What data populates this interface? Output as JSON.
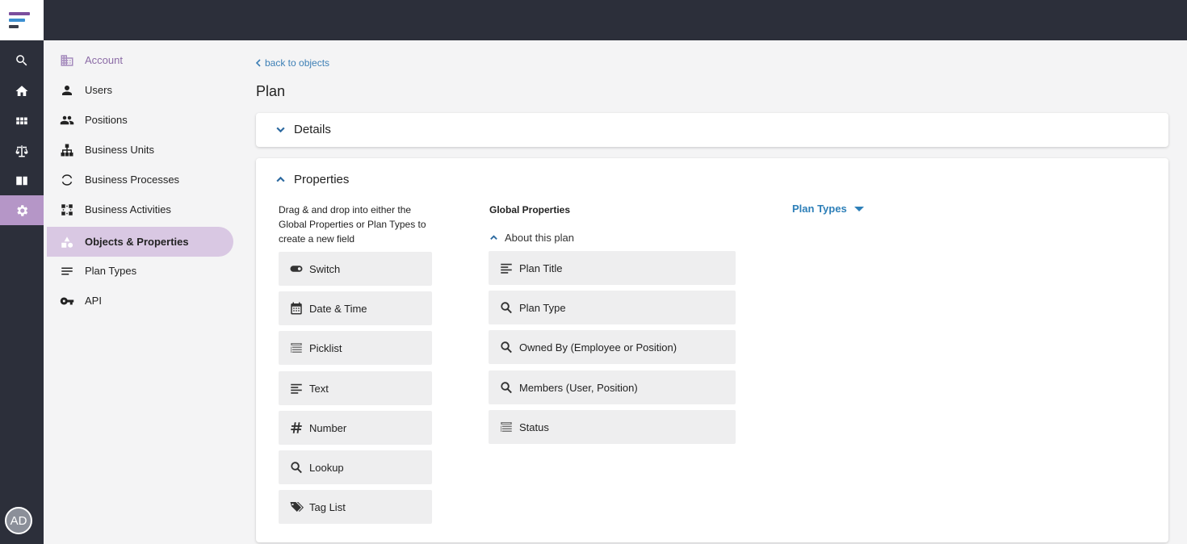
{
  "brand": {
    "logo_colors": [
      "#7b4e9d",
      "#3c8fd0",
      "#3b3f4c"
    ]
  },
  "rail": {
    "items": [
      {
        "icon": "search-icon",
        "active": false
      },
      {
        "icon": "home-icon",
        "active": false
      },
      {
        "icon": "grid-icon",
        "active": false
      },
      {
        "icon": "scales-icon",
        "active": false
      },
      {
        "icon": "book-icon",
        "active": false
      },
      {
        "icon": "gear-icon",
        "active": true
      }
    ],
    "avatar_initials": "AD"
  },
  "sidebar": {
    "items": [
      {
        "label": "Account",
        "icon": "building-icon"
      },
      {
        "label": "Users",
        "icon": "person-icon"
      },
      {
        "label": "Positions",
        "icon": "people-icon"
      },
      {
        "label": "Business Units",
        "icon": "hierarchy-icon"
      },
      {
        "label": "Business Processes",
        "icon": "cycle-icon"
      },
      {
        "label": "Business Activities",
        "icon": "activity-icon"
      },
      {
        "label": "Objects & Properties",
        "icon": "shapes-icon",
        "active": true
      },
      {
        "label": "Plan Types",
        "icon": "lines-icon"
      },
      {
        "label": "API",
        "icon": "key-icon"
      }
    ]
  },
  "main": {
    "back_link": "back to objects",
    "title": "Plan",
    "details": {
      "label": "Details"
    },
    "properties": {
      "label": "Properties",
      "instructions": "Drag & and drop into either the Global Properties or Plan Types to create a new field",
      "palette": [
        {
          "label": "Switch",
          "icon": "toggle-icon"
        },
        {
          "label": "Date & Time",
          "icon": "calendar-icon"
        },
        {
          "label": "Picklist",
          "icon": "picklist-icon"
        },
        {
          "label": "Text",
          "icon": "text-lines-icon"
        },
        {
          "label": "Number",
          "icon": "hash-icon"
        },
        {
          "label": "Lookup",
          "icon": "magnifier-icon"
        },
        {
          "label": "Tag List",
          "icon": "tag-icon"
        }
      ],
      "global": {
        "title": "Global Properties",
        "section_label": "About this plan",
        "fields": [
          {
            "label": "Plan Title",
            "icon": "text-lines-icon"
          },
          {
            "label": "Plan Type",
            "icon": "magnifier-icon"
          },
          {
            "label": "Owned By (Employee or Position)",
            "icon": "magnifier-icon"
          },
          {
            "label": "Members (User, Position)",
            "icon": "magnifier-icon"
          },
          {
            "label": "Status",
            "icon": "picklist-icon"
          }
        ]
      },
      "plan_types": {
        "title": "Plan Types"
      }
    }
  },
  "colors": {
    "topbar": "#2c2f3a",
    "accent_purple": "#b596c7",
    "active_nav": "#d9c8e3",
    "link_blue": "#2d7fb8"
  }
}
